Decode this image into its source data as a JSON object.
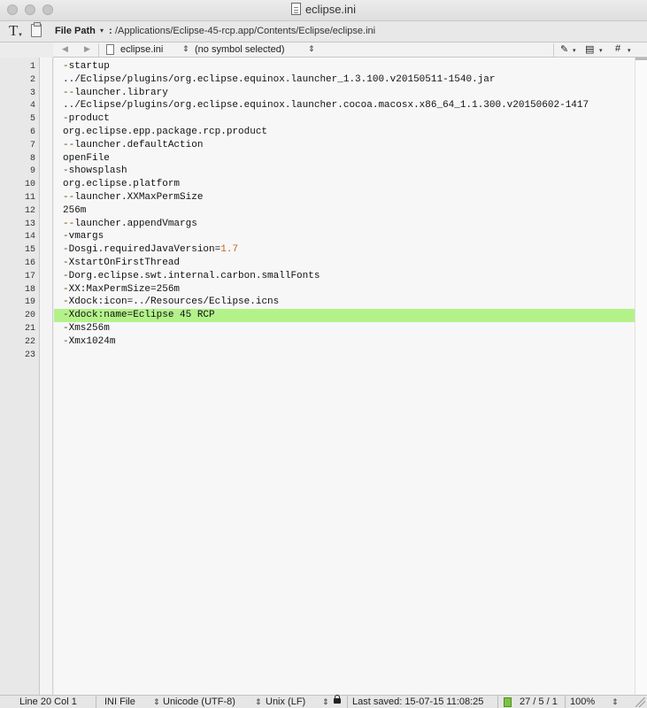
{
  "window": {
    "title": "eclipse.ini"
  },
  "pathbar": {
    "text_tool_label": "T",
    "path_label": "File Path",
    "path_caret": "▾",
    "path_colon": ":",
    "path_value": "/Applications/Eclipse-45-rcp.app/Contents/Eclipse/eclipse.ini"
  },
  "navbar": {
    "back": "◀",
    "forward": "▶",
    "file_name": "eclipse.ini",
    "file_updown": "⇕",
    "symbol": "(no symbol selected)",
    "symbol_updown": "⇕",
    "tool_pen": "✎",
    "tool_doc": "▤",
    "tool_hash": "#",
    "caret": "▾"
  },
  "editor": {
    "lines": [
      {
        "n": "1",
        "text": "-startup"
      },
      {
        "n": "2",
        "text": "../Eclipse/plugins/org.eclipse.equinox.launcher_1.3.100.v20150511-1540.jar"
      },
      {
        "n": "3",
        "text": "--launcher.library"
      },
      {
        "n": "4",
        "text": "../Eclipse/plugins/org.eclipse.equinox.launcher.cocoa.macosx.x86_64_1.1.300.v20150602-1417"
      },
      {
        "n": "5",
        "text": "-product"
      },
      {
        "n": "6",
        "text": "org.eclipse.epp.package.rcp.product"
      },
      {
        "n": "7",
        "text": "--launcher.defaultAction"
      },
      {
        "n": "8",
        "text": "openFile"
      },
      {
        "n": "9",
        "text": "-showsplash"
      },
      {
        "n": "10",
        "text": "org.eclipse.platform"
      },
      {
        "n": "11",
        "text": "--launcher.XXMaxPermSize"
      },
      {
        "n": "12",
        "text": "256m"
      },
      {
        "n": "13",
        "text": "--launcher.appendVmargs"
      },
      {
        "n": "14",
        "text": "-vmargs"
      },
      {
        "n": "15",
        "text": "-Dosgi.requiredJavaVersion=1.7"
      },
      {
        "n": "16",
        "text": "-XstartOnFirstThread"
      },
      {
        "n": "17",
        "text": "-Dorg.eclipse.swt.internal.carbon.smallFonts"
      },
      {
        "n": "18",
        "text": "-XX:MaxPermSize=256m"
      },
      {
        "n": "19",
        "text": "-Xdock:icon=../Resources/Eclipse.icns"
      },
      {
        "n": "20",
        "text": "-Xdock:name=Eclipse 45 RCP"
      },
      {
        "n": "21",
        "text": "-Xms256m"
      },
      {
        "n": "22",
        "text": "-Xmx1024m"
      },
      {
        "n": "23",
        "text": ""
      }
    ],
    "highlighted_line": "20",
    "highlight_color": "#b3f28b"
  },
  "statusbar": {
    "position": "Line 20 Col 1",
    "syntax": "INI File",
    "encoding": "Unicode (UTF-8)",
    "line_endings": "Unix (LF)",
    "updown": "⇕",
    "last_saved": "Last saved: 15-07-15 11:08:25",
    "stats": "27 / 5 / 1",
    "zoom": "100%"
  }
}
